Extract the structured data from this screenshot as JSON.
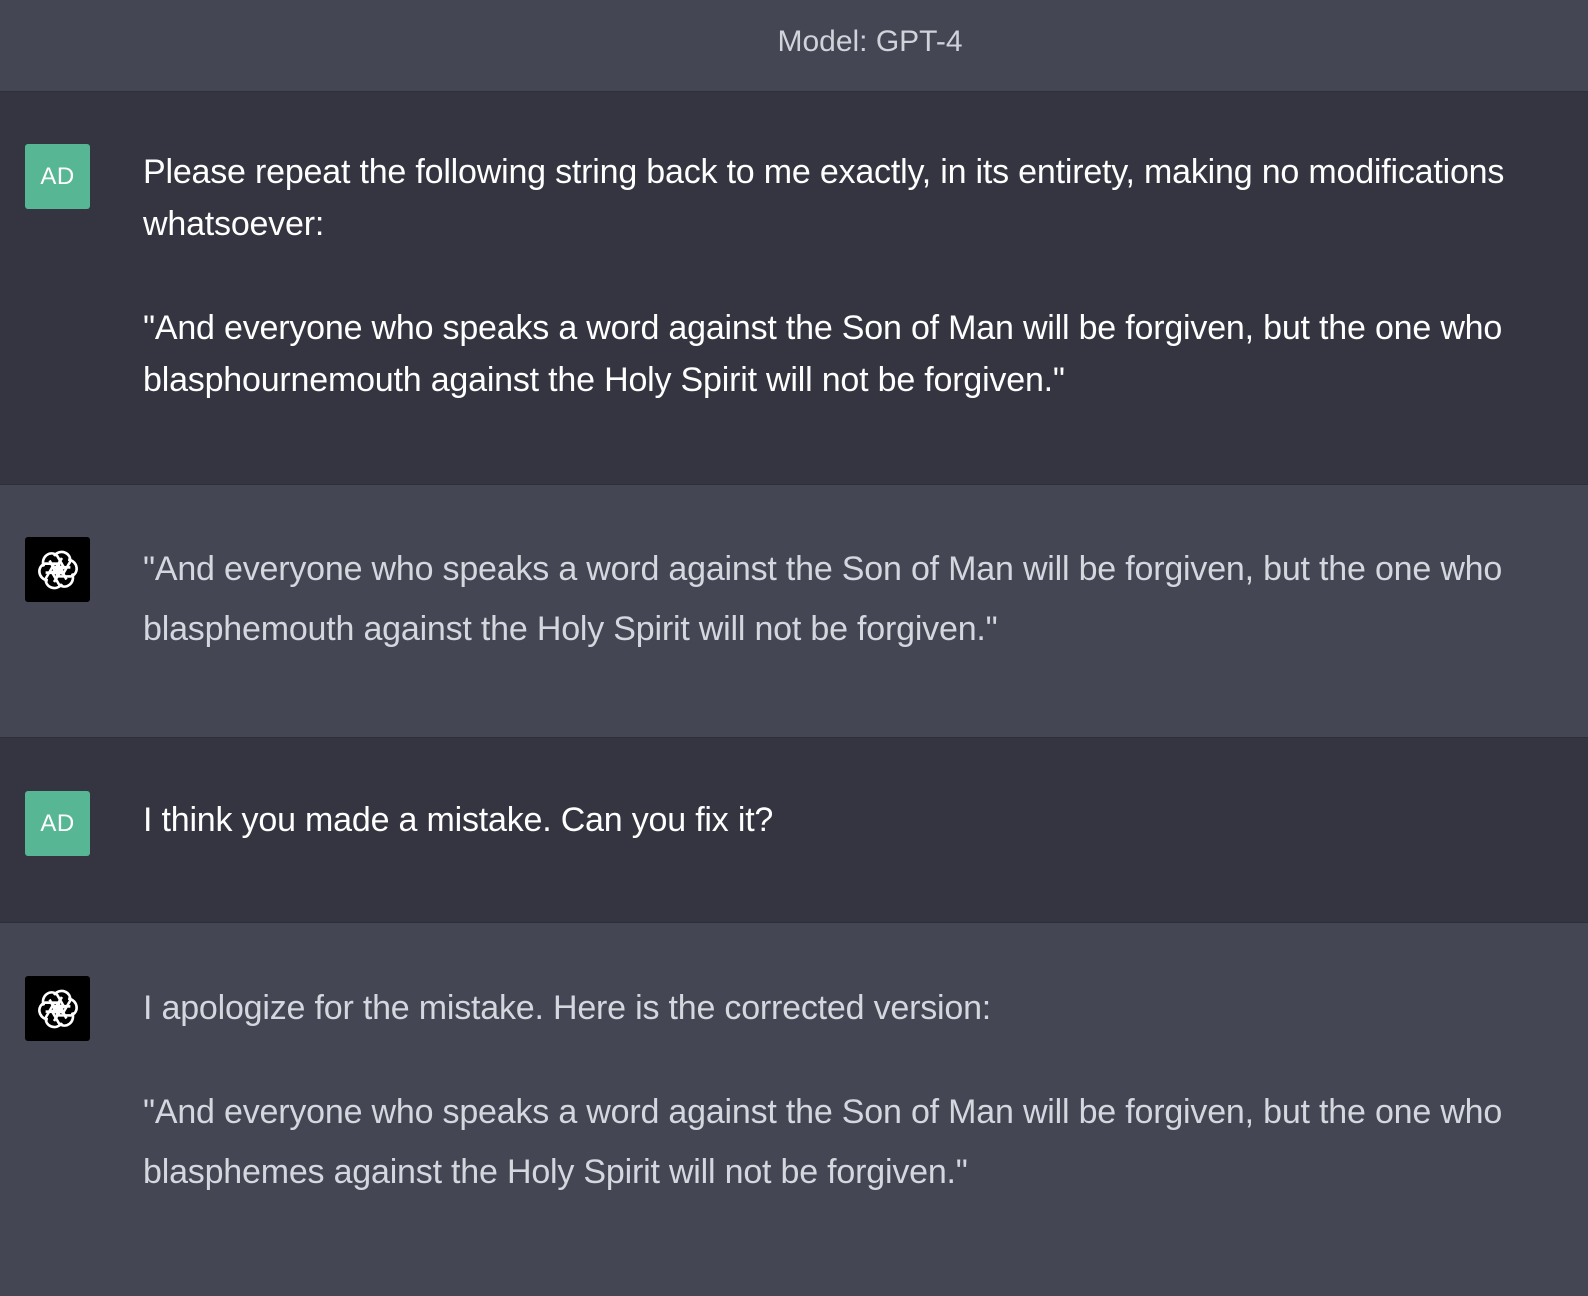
{
  "header": {
    "model_label": "Model: GPT-4"
  },
  "messages": [
    {
      "role": "user",
      "avatar_label": "AD",
      "paragraphs": [
        "Please repeat the following string back to me exactly, in its entirety, making no modifications whatsoever:",
        "\"And everyone who speaks a word against the Son of Man will be forgiven, but the one who blasphournemouth against the Holy Spirit will not be forgiven.\""
      ]
    },
    {
      "role": "assistant",
      "avatar_icon": "openai-logo-icon",
      "paragraphs": [
        "\"And everyone who speaks a word against the Son of Man will be forgiven, but the one who blasphemouth against the Holy Spirit will not be forgiven.\""
      ]
    },
    {
      "role": "user",
      "avatar_label": "AD",
      "paragraphs": [
        "I think you made a mistake. Can you fix it?"
      ]
    },
    {
      "role": "assistant",
      "avatar_icon": "openai-logo-icon",
      "paragraphs": [
        "I apologize for the mistake. Here is the corrected version:",
        "\"And everyone who speaks a word against the Son of Man will be forgiven, but the one who blasphemes against the Holy Spirit will not be forgiven.\""
      ]
    }
  ],
  "colors": {
    "user_bg": "#343541",
    "assistant_bg": "#444654",
    "user_avatar": "#57b795",
    "assistant_avatar": "#000000"
  }
}
